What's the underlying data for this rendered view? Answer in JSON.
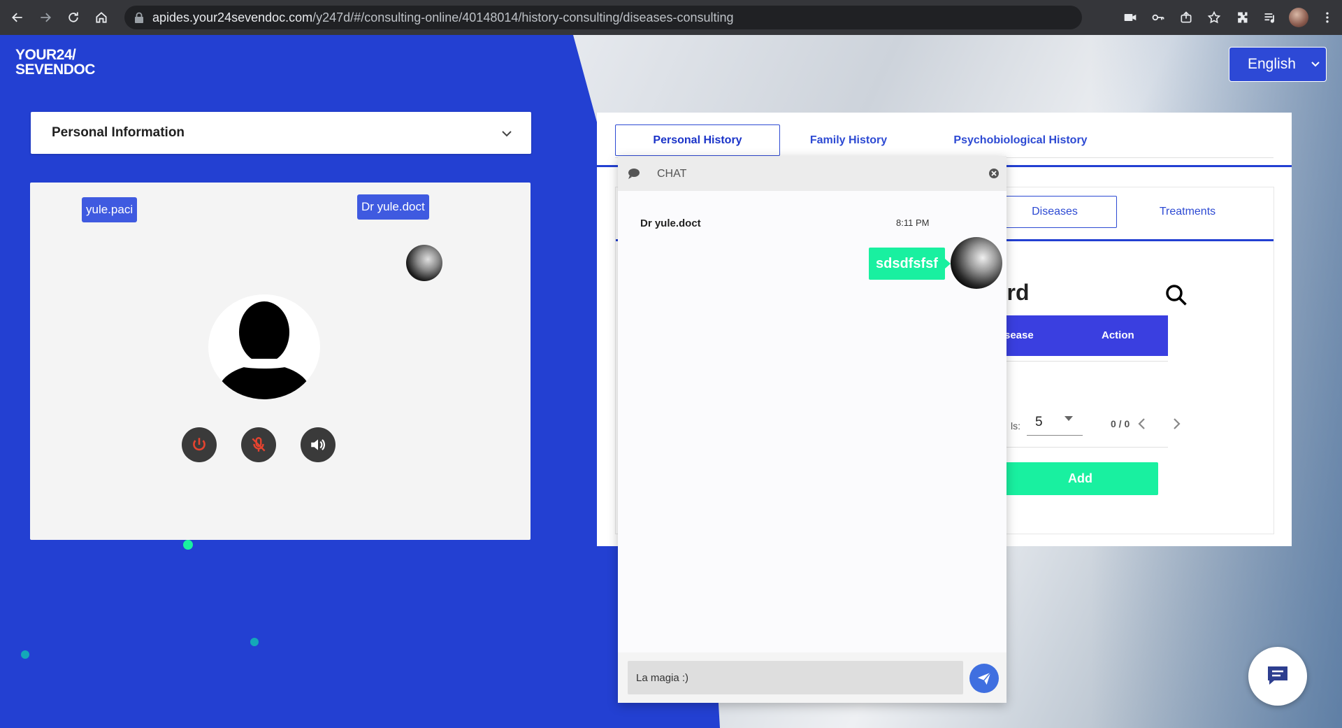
{
  "browser": {
    "url_host": "apides.your24sevendoc.com",
    "url_path": "/y247d/#/consulting-online/40148014/history-consulting/diseases-consulting"
  },
  "brand": {
    "logo_line1": "YOUR24/",
    "logo_line2": "SEVENDOC"
  },
  "language": {
    "selected": "English"
  },
  "personal_info": {
    "title": "Personal Information"
  },
  "video": {
    "patient_tag": "yule.paci",
    "doctor_tag": "Dr yule.doct",
    "controls": [
      "power-icon",
      "mic-off-icon",
      "speaker-icon"
    ]
  },
  "history": {
    "tabs": [
      {
        "label": "Personal History",
        "active": true
      },
      {
        "label": "Family History",
        "active": false
      },
      {
        "label": "Psychobiological History",
        "active": false
      }
    ],
    "sub_tabs": [
      {
        "label": "Diseases",
        "active": true
      },
      {
        "label": "Treatments",
        "active": false
      }
    ],
    "section_title_visible": "ord",
    "table_headers": [
      "Disease",
      "Action"
    ],
    "table_empty_cell": ".",
    "pagination": {
      "label_visible": "ls:",
      "rows_per_page": "5",
      "count": "0 / 0"
    },
    "add_label": "Add"
  },
  "chat": {
    "title": "CHAT",
    "messages": [
      {
        "sender": "Dr yule.doct",
        "time": "8:11 PM",
        "text": "sdsdfsfsf"
      }
    ],
    "input_value": "La magia :)"
  },
  "colors": {
    "page_blue": "#2340d2",
    "accent_green": "#19f0a0",
    "table_head": "#3a3fe0",
    "send_blue": "#3f6fe0"
  }
}
